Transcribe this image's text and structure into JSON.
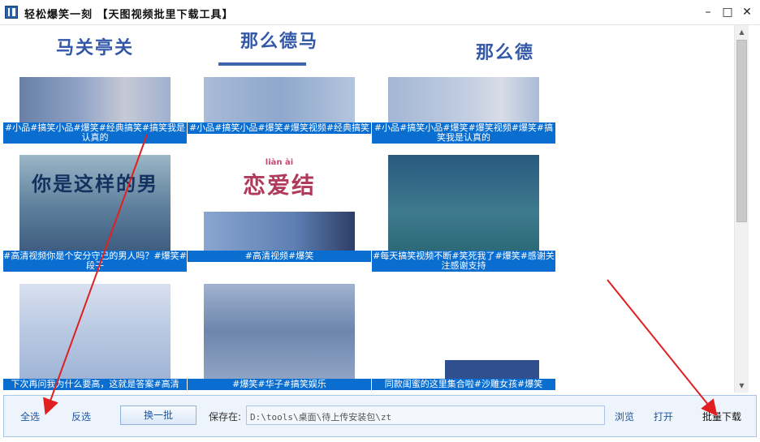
{
  "window": {
    "title": "轻松爆笑一刻 【天图视频批里下载工具】",
    "minimize": "–",
    "maximize": "□",
    "close": "✕"
  },
  "videos": [
    {
      "overlay": "马关亭关",
      "caption": "#小品#搞笑小品#爆笑#经典搞笑#搞笑我是认真的"
    },
    {
      "overlay": "那么德马",
      "caption": "#小品#搞笑小品#爆笑#爆笑视频#经典搞笑"
    },
    {
      "overlay": "那么德",
      "caption": "#小品#搞笑小品#爆笑#爆笑视频#爆笑#搞笑我是认真的"
    },
    {
      "overlay": "你是这样的男",
      "caption": "#高清视频你是个安分守己的男人吗？#爆笑#段子"
    },
    {
      "overlay": "恋爱结",
      "subtitle": "liàn ài",
      "caption": "#高清视频#爆笑"
    },
    {
      "overlay": "",
      "caption": "#每天搞笑视频不断#笑死我了#爆笑#感谢关注感谢支持"
    },
    {
      "overlay": "",
      "caption": "下次再问我为什么要高，这就是答案#高清"
    },
    {
      "overlay": "",
      "caption": "#爆笑#华子#搞笑娱乐"
    },
    {
      "overlay": "",
      "caption": "同款闺蜜的这里集合啦#沙雕女孩#爆笑"
    }
  ],
  "scrollbar": {
    "up": "▲",
    "down": "▼"
  },
  "toolbar": {
    "select_all": "全选",
    "invert": "反选",
    "next_batch": "换一批",
    "save_label": "保存在:",
    "save_path": "D:\\tools\\桌面\\待上传安装包\\zt",
    "browse": "浏览",
    "open": "打开",
    "batch_download": "批量下载"
  },
  "colors": {
    "caption_bg": "#0a6ed1",
    "accent": "#1e57a3",
    "annotation_arrow": "#e02020"
  }
}
